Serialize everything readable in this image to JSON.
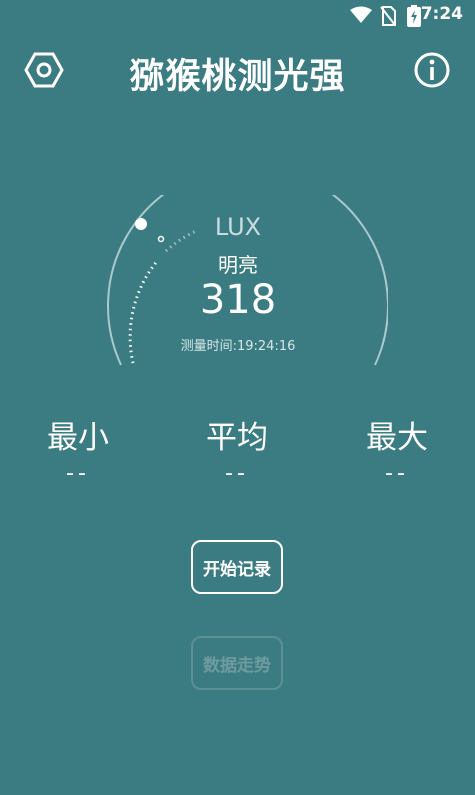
{
  "status_bar": {
    "time": "7:24",
    "icons": [
      "wifi-icon",
      "no-sim-icon",
      "battery-charging-icon"
    ]
  },
  "header": {
    "title": "猕猴桃测光强",
    "left_icon": "settings-hexagon-icon",
    "right_icon": "info-icon"
  },
  "gauge": {
    "unit": "LUX",
    "level": "明亮",
    "value": "318",
    "time": "测量时间:19:24:16"
  },
  "stats": {
    "min": {
      "label": "最小",
      "value": "--"
    },
    "avg": {
      "label": "平均",
      "value": "--"
    },
    "max": {
      "label": "最大",
      "value": "--"
    }
  },
  "buttons": {
    "record": "开始记录",
    "trend": "数据走势"
  },
  "colors": {
    "background": "#3b7c82",
    "text": "#ffffff",
    "disabled": "#6e9b9f"
  }
}
